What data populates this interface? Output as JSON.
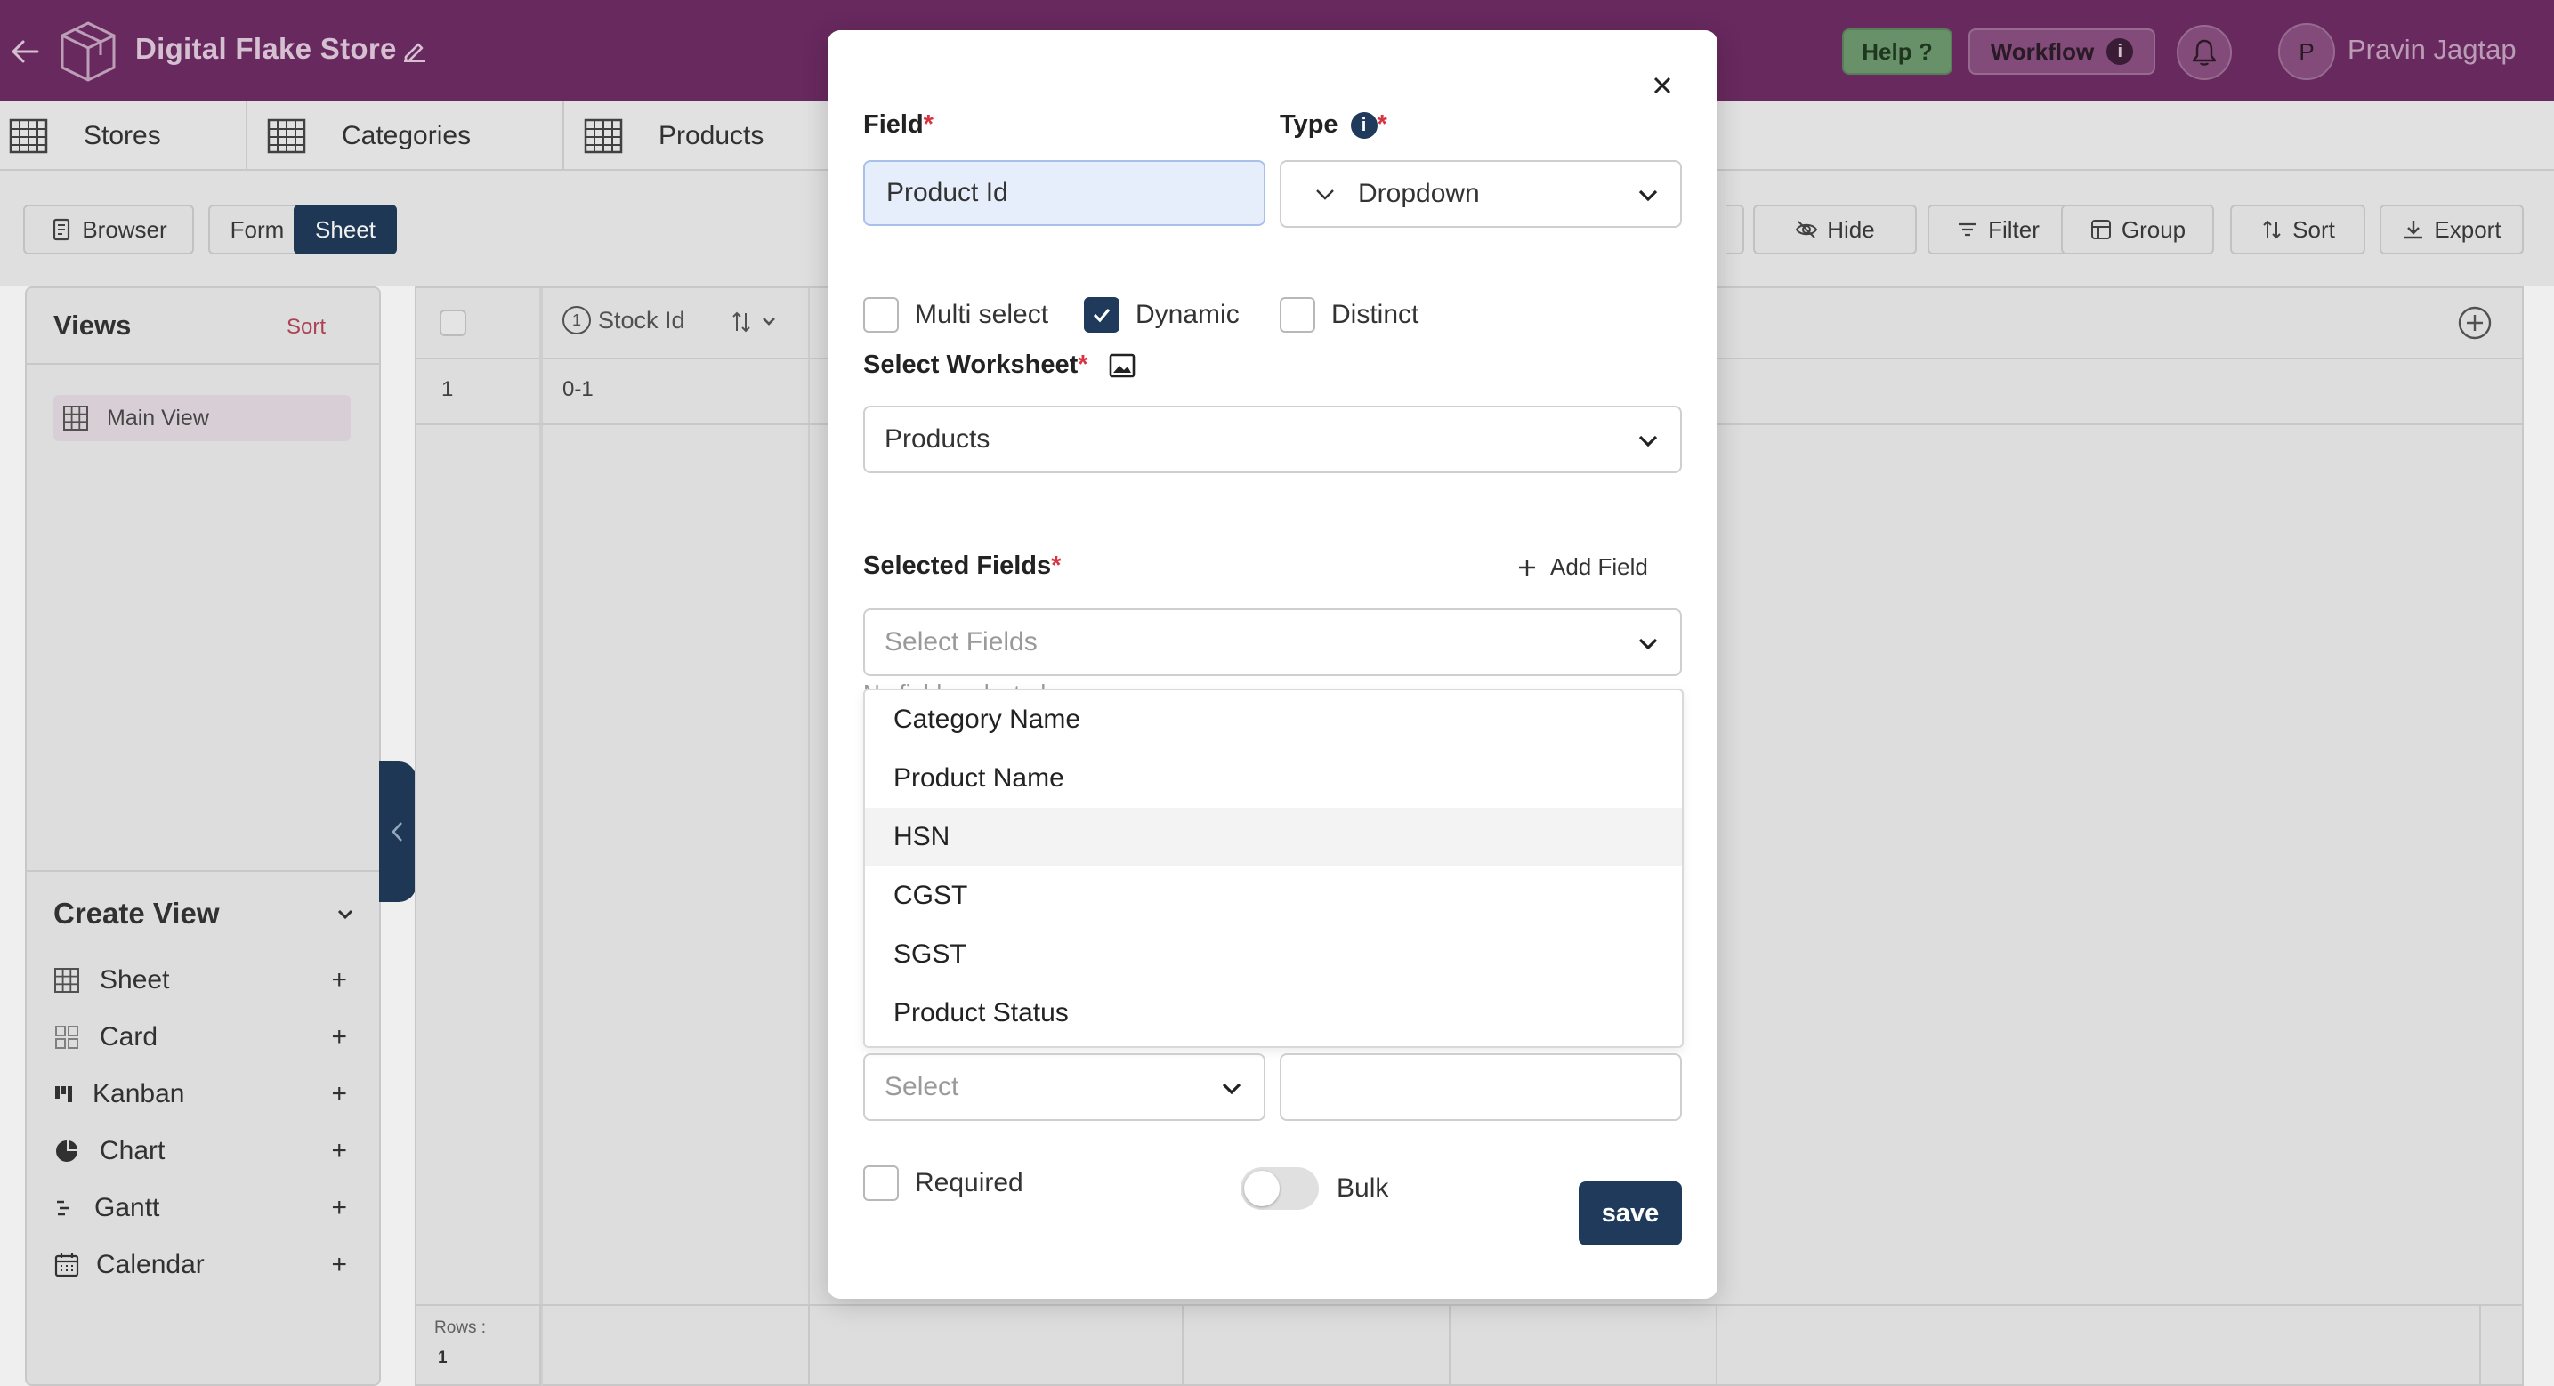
{
  "topbar": {
    "app_title": "Digital Flake Store",
    "help_label": "Help ?",
    "workflow_label": "Workflow",
    "workflow_info": "i",
    "avatar_initial": "P",
    "user_name": "Pravin Jagtap",
    "bg_color": "#6e2b64"
  },
  "tabs": [
    {
      "label": "Stores"
    },
    {
      "label": "Categories"
    },
    {
      "label": "Products"
    }
  ],
  "toolbar": {
    "browser_label": "Browser",
    "form_label": "Form",
    "sheet_label": "Sheet",
    "hide_label": "Hide",
    "filter_label": "Filter",
    "group_label": "Group",
    "sort_label": "Sort",
    "export_label": "Export"
  },
  "views": {
    "title": "Views",
    "sort_label": "Sort",
    "items": [
      {
        "label": "Main View"
      }
    ]
  },
  "create_view": {
    "title": "Create View",
    "items": [
      {
        "label": "Sheet",
        "icon": "grid-icon"
      },
      {
        "label": "Card",
        "icon": "cards-icon"
      },
      {
        "label": "Kanban",
        "icon": "kanban-icon"
      },
      {
        "label": "Chart",
        "icon": "pie-chart-icon"
      },
      {
        "label": "Gantt",
        "icon": "gantt-icon"
      },
      {
        "label": "Calendar",
        "icon": "calendar-icon"
      }
    ],
    "plus": "+"
  },
  "grid": {
    "column_number": "1",
    "column_header": "Stock Id",
    "rows": [
      {
        "index": "1",
        "stock_id": "0-1"
      }
    ],
    "rows_label": "Rows :",
    "rows_count": "1"
  },
  "modal": {
    "field_label": "Field",
    "field_value": "Product Id",
    "type_label": "Type",
    "type_value": "Dropdown",
    "required_mark": "*",
    "info": "i",
    "checkboxes": [
      {
        "label": "Multi select",
        "checked": false
      },
      {
        "label": "Dynamic",
        "checked": true
      },
      {
        "label": "Distinct",
        "checked": false
      }
    ],
    "worksheet_label": "Select Worksheet",
    "worksheet_value": "Products",
    "selected_fields_label": "Selected Fields",
    "add_field_label": "Add Field",
    "select_fields_placeholder": "Select Fields",
    "no_fields_text": "No fields selected",
    "dropdown_options": [
      "Category Name",
      "Product Name",
      "HSN",
      "CGST",
      "SGST",
      "Product Status"
    ],
    "bottom_select_placeholder": "Select",
    "required_label": "Required",
    "bulk_label": "Bulk",
    "save_label": "save"
  },
  "colors": {
    "accent": "#1f3a5a",
    "required": "#d9333f",
    "help": "#6f9a6f"
  }
}
